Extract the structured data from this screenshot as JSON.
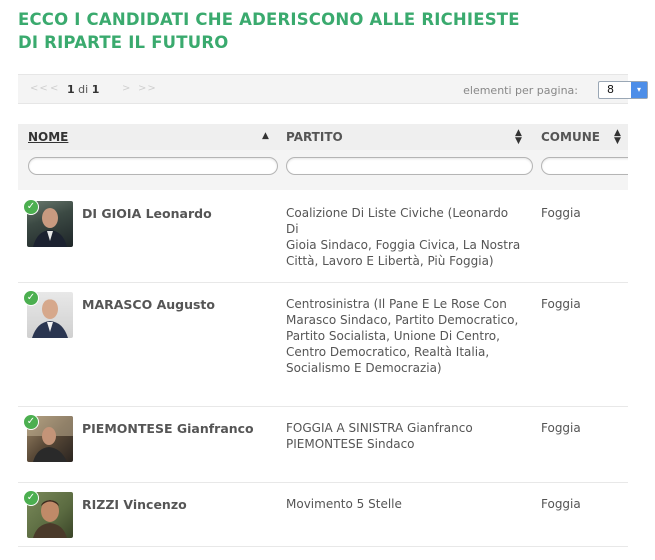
{
  "heading": {
    "line1": "ECCO I CANDIDATI CHE ADERISCONO ALLE RICHIESTE",
    "line2": "DI RIPARTE IL FUTURO"
  },
  "pager": {
    "first": "<<",
    "prev": "<",
    "current": "1",
    "of": "di",
    "total": "1",
    "next": ">",
    "last": ">>",
    "per_page_label": "elementi per pagina:",
    "per_page_value": "8"
  },
  "columns": {
    "nome": "NOME",
    "partito": "PARTITO",
    "comune": "COMUNE"
  },
  "colors": {
    "heading": "#3aaa6e",
    "check": "#4caf50",
    "select_arrow": "#4d8ee8"
  },
  "candidates": [
    {
      "name": "DI GIOIA Leonardo",
      "party_lines": [
        "Coalizione Di Liste Civiche (Leonardo Di",
        "Gioia Sindaco, Foggia Civica, La Nostra",
        "Città, Lavoro E Libertà, Più Foggia)"
      ],
      "city": "Foggia"
    },
    {
      "name": "MARASCO Augusto",
      "party_lines": [
        "Centrosinistra (Il Pane E Le Rose Con",
        "Marasco Sindaco, Partito Democratico,",
        "Partito Socialista, Unione Di Centro,",
        "Centro Democratico, Realtà Italia,",
        "Socialismo E Democrazia)"
      ],
      "city": "Foggia"
    },
    {
      "name": "PIEMONTESE Gianfranco",
      "party_lines": [
        "FOGGIA A SINISTRA Gianfranco",
        "PIEMONTESE Sindaco"
      ],
      "city": "Foggia"
    },
    {
      "name": "RIZZI Vincenzo",
      "party_lines": [
        "Movimento 5 Stelle"
      ],
      "city": "Foggia"
    }
  ]
}
